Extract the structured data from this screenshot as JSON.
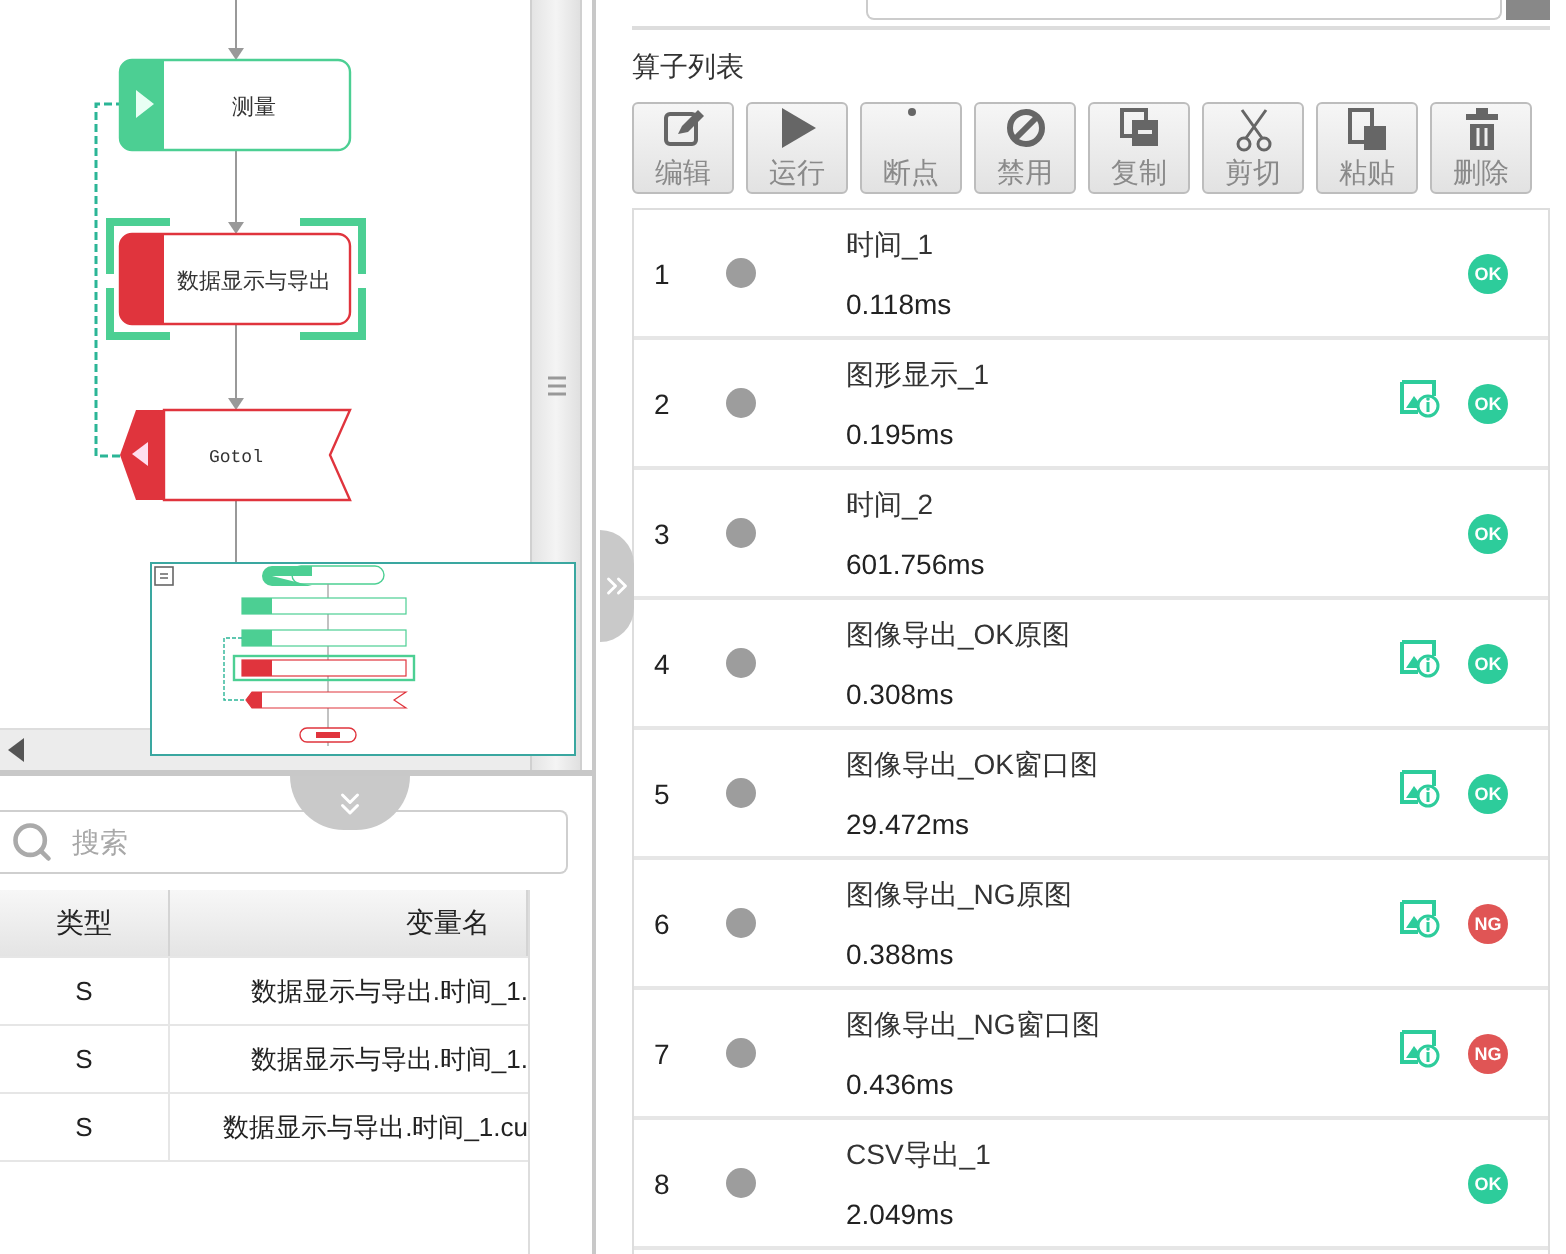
{
  "flow": {
    "nodes": [
      {
        "label": "测量",
        "kind": "start",
        "color": "#4ccf93",
        "selected": false
      },
      {
        "label": "数据显示与导出",
        "kind": "block",
        "color": "#e0343d",
        "selected": true
      },
      {
        "label": "Gotol",
        "kind": "goto",
        "color": "#e0343d",
        "selected": false
      }
    ]
  },
  "variables": {
    "search": {
      "placeholder": "搜索"
    },
    "columns": [
      "类型",
      "变量名"
    ],
    "rows": [
      {
        "type": "S",
        "name": "数据显示与导出.时间_1."
      },
      {
        "type": "S",
        "name": "数据显示与导出.时间_1."
      },
      {
        "type": "S",
        "name": "数据显示与导出.时间_1.cu"
      }
    ]
  },
  "operators": {
    "title": "算子列表",
    "toolbar": [
      {
        "label": "编辑",
        "kind": "edit"
      },
      {
        "label": "运行",
        "kind": "run"
      },
      {
        "label": "断点",
        "kind": "breakpoint"
      },
      {
        "label": "禁用",
        "kind": "disable"
      },
      {
        "label": "复制",
        "kind": "copy"
      },
      {
        "label": "剪切",
        "kind": "cut"
      },
      {
        "label": "粘贴",
        "kind": "paste"
      },
      {
        "label": "删除",
        "kind": "delete"
      }
    ],
    "rows": [
      {
        "index": "1",
        "name": "时间_1",
        "time": "0.118ms",
        "image_output": false,
        "result": {
          "label": "OK",
          "color": "#2dcc9b"
        }
      },
      {
        "index": "2",
        "name": "图形显示_1",
        "time": "0.195ms",
        "image_output": true,
        "result": {
          "label": "OK",
          "color": "#2dcc9b"
        }
      },
      {
        "index": "3",
        "name": "时间_2",
        "time": "601.756ms",
        "image_output": false,
        "result": {
          "label": "OK",
          "color": "#2dcc9b"
        }
      },
      {
        "index": "4",
        "name": "图像导出_OK原图",
        "time": "0.308ms",
        "image_output": true,
        "result": {
          "label": "OK",
          "color": "#2dcc9b"
        }
      },
      {
        "index": "5",
        "name": "图像导出_OK窗口图",
        "time": "29.472ms",
        "image_output": true,
        "result": {
          "label": "OK",
          "color": "#2dcc9b"
        }
      },
      {
        "index": "6",
        "name": "图像导出_NG原图",
        "time": "0.388ms",
        "image_output": true,
        "result": {
          "label": "NG",
          "color": "#e05555"
        }
      },
      {
        "index": "7",
        "name": "图像导出_NG窗口图",
        "time": "0.436ms",
        "image_output": true,
        "result": {
          "label": "NG",
          "color": "#e05555"
        }
      },
      {
        "index": "8",
        "name": "CSV导出_1",
        "time": "2.049ms",
        "image_output": false,
        "result": {
          "label": "OK",
          "color": "#2dcc9b"
        }
      }
    ]
  }
}
